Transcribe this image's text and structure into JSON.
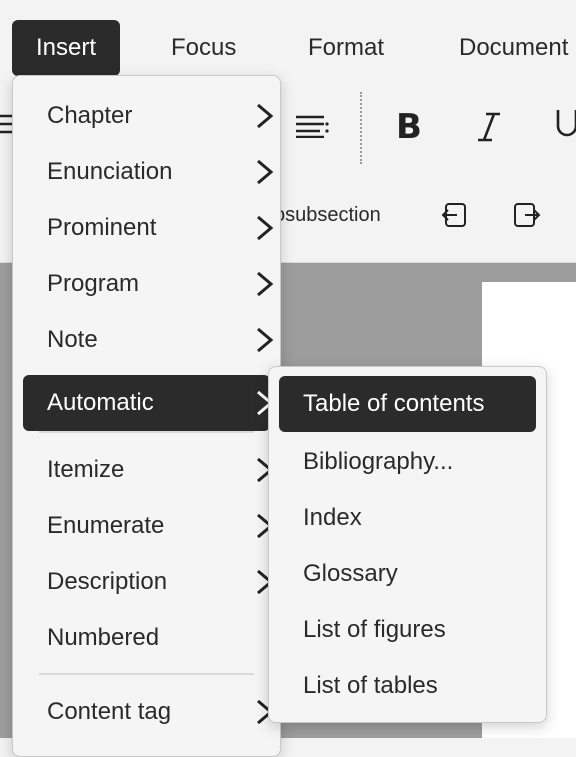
{
  "menubar": {
    "items": [
      {
        "label": "Insert",
        "active": true
      },
      {
        "label": "Focus"
      },
      {
        "label": "Format"
      },
      {
        "label": "Document"
      }
    ]
  },
  "toolbar": {
    "subsection_label": "osubsection"
  },
  "insert_menu": {
    "items": [
      {
        "label": "Chapter",
        "has_submenu": true
      },
      {
        "label": "Enunciation",
        "has_submenu": true
      },
      {
        "label": "Prominent",
        "has_submenu": true
      },
      {
        "label": "Program",
        "has_submenu": true
      },
      {
        "label": "Note",
        "has_submenu": true
      },
      {
        "label": "Automatic",
        "has_submenu": true,
        "active": true
      },
      {
        "label": "Itemize",
        "has_submenu": true
      },
      {
        "label": "Enumerate",
        "has_submenu": true
      },
      {
        "label": "Description",
        "has_submenu": true
      },
      {
        "label": "Numbered",
        "has_submenu": false
      },
      {
        "label": "Content tag",
        "has_submenu": true
      }
    ]
  },
  "automatic_submenu": {
    "items": [
      {
        "label": "Table of contents",
        "active": true
      },
      {
        "label": "Bibliography..."
      },
      {
        "label": "Index"
      },
      {
        "label": "Glossary"
      },
      {
        "label": "List of figures"
      },
      {
        "label": "List of tables"
      }
    ]
  },
  "colors": {
    "highlight": "#2b2b2b",
    "menu_bg": "#f5f5f5",
    "doc_bg": "#9d9d9d"
  }
}
